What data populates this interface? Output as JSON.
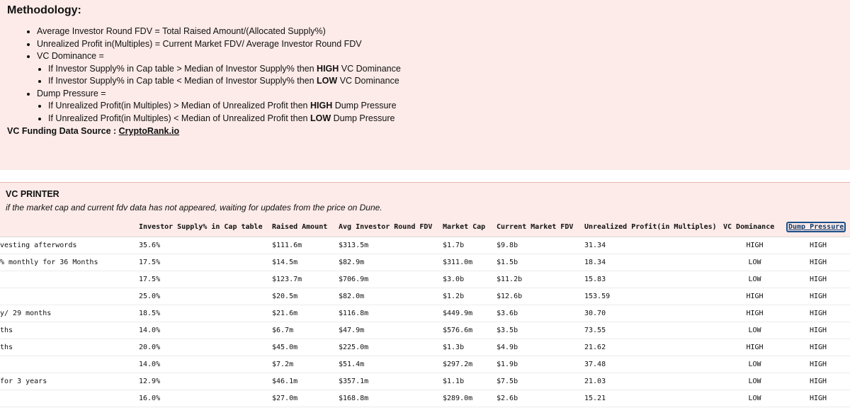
{
  "methodology": {
    "title": "Methodology:",
    "items": [
      "Average Investor Round FDV = Total Raised Amount/(Allocated Supply%)",
      "Unrealized Profit in(Multiples) = Current Market FDV/ Average Investor Round FDV",
      "VC Dominance ="
    ],
    "vc_sub": [
      {
        "pre": "If Investor Supply% in Cap table > Median of Investor Supply% then ",
        "bold": "HIGH",
        "post": " VC Dominance"
      },
      {
        "pre": "If Investor Supply% in Cap table < Median of Investor Supply% then ",
        "bold": "LOW",
        "post": " VC Dominance"
      }
    ],
    "dump_label": "Dump Pressure =",
    "dump_sub": [
      {
        "pre": "If Unrealized Profit(in Multiples) > Median of Unrealized Profit then ",
        "bold": "HIGH",
        "post": " Dump Pressure"
      },
      {
        "pre": "If Unrealized Profit(in Multiples) < Median of Unrealized Profit then ",
        "bold": "LOW",
        "post": " Dump Pressure"
      }
    ],
    "source_label": "VC Funding Data Source : ",
    "source_link": "CryptoRank.io"
  },
  "panel": {
    "title": "VC PRINTER",
    "note": "if the market cap and current fdv data has not appeared, waiting for updates from the price on Dune."
  },
  "table": {
    "columns": [
      "",
      "Investor Supply% in Cap table",
      "Raised Amount",
      "Avg Investor Round FDV",
      "Market Cap",
      "Current Market FDV",
      "Unrealized Profit(in Multiples)",
      "VC Dominance",
      "Dump Pressure"
    ],
    "rows": [
      [
        " vesting afterwords",
        "35.6%",
        "$111.6m",
        "$313.5m",
        "$1.7b",
        "$9.8b",
        "31.34",
        "HIGH",
        "HIGH"
      ],
      [
        "% monthly for 36 Months",
        "17.5%",
        "$14.5m",
        "$82.9m",
        "$311.0m",
        "$1.5b",
        "18.34",
        "LOW",
        "HIGH"
      ],
      [
        "",
        "17.5%",
        "$123.7m",
        "$706.9m",
        "$3.0b",
        "$11.2b",
        "15.83",
        "LOW",
        "HIGH"
      ],
      [
        "",
        "25.0%",
        "$20.5m",
        "$82.0m",
        "$1.2b",
        "$12.6b",
        "153.59",
        "HIGH",
        "HIGH"
      ],
      [
        "y/ 29 months",
        "18.5%",
        "$21.6m",
        "$116.8m",
        "$449.9m",
        "$3.6b",
        "30.70",
        "HIGH",
        "HIGH"
      ],
      [
        "ths",
        "14.0%",
        "$6.7m",
        "$47.9m",
        "$576.6m",
        "$3.5b",
        "73.55",
        "LOW",
        "HIGH"
      ],
      [
        "ths",
        "20.0%",
        "$45.0m",
        "$225.0m",
        "$1.3b",
        "$4.9b",
        "21.62",
        "HIGH",
        "HIGH"
      ],
      [
        "",
        "14.0%",
        "$7.2m",
        "$51.4m",
        "$297.2m",
        "$1.9b",
        "37.48",
        "LOW",
        "HIGH"
      ],
      [
        " for 3 years",
        "12.9%",
        "$46.1m",
        "$357.1m",
        "$1.1b",
        "$7.5b",
        "21.03",
        "LOW",
        "HIGH"
      ],
      [
        "",
        "16.0%",
        "$27.0m",
        "$168.8m",
        "$289.0m",
        "$2.6b",
        "15.21",
        "LOW",
        "HIGH"
      ]
    ]
  }
}
